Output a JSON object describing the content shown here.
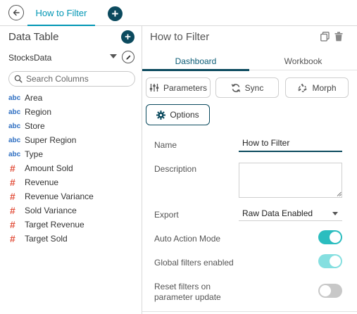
{
  "top_tabs": {
    "active_tab_label": "How to Filter"
  },
  "data_table": {
    "title": "Data Table",
    "data_source": "StocksData",
    "search_placeholder": "Search Columns",
    "columns": [
      {
        "type": "text",
        "type_badge": "abc",
        "label": "Area"
      },
      {
        "type": "text",
        "type_badge": "abc",
        "label": "Region"
      },
      {
        "type": "text",
        "type_badge": "abc",
        "label": "Store"
      },
      {
        "type": "text",
        "type_badge": "abc",
        "label": "Super Region"
      },
      {
        "type": "text",
        "type_badge": "abc",
        "label": "Type"
      },
      {
        "type": "number",
        "type_badge": "#",
        "label": "Amount Sold"
      },
      {
        "type": "number",
        "type_badge": "#",
        "label": "Revenue"
      },
      {
        "type": "number",
        "type_badge": "#",
        "label": "Revenue Variance"
      },
      {
        "type": "number",
        "type_badge": "#",
        "label": "Sold Variance"
      },
      {
        "type": "number",
        "type_badge": "#",
        "label": "Target Revenue"
      },
      {
        "type": "number",
        "type_badge": "#",
        "label": "Target Sold"
      }
    ]
  },
  "properties": {
    "title": "How to Filter",
    "subtabs": {
      "dashboard": "Dashboard",
      "workbook": "Workbook"
    },
    "buttons": {
      "parameters": "Parameters",
      "sync": "Sync",
      "morph": "Morph",
      "options": "Options"
    },
    "form": {
      "name_label": "Name",
      "name_value": "How to Filter",
      "description_label": "Description",
      "description_value": "",
      "export_label": "Export",
      "export_value": "Raw Data Enabled",
      "auto_action_label": "Auto Action Mode",
      "auto_action_on": true,
      "global_filters_label": "Global filters enabled",
      "global_filters_on": true,
      "reset_filters_label_line1": "Reset filters on",
      "reset_filters_label_line2": "parameter update",
      "reset_filters_on": false
    }
  },
  "colors": {
    "accent": "#0096b4",
    "dark_teal": "#0b4a5e",
    "toggle_on": "#2bbdbf",
    "text_type": "#2f6fc2",
    "number_type": "#e2503c"
  },
  "icons": {
    "back": "back-arrow-icon",
    "add": "plus-icon",
    "edit": "pencil-icon",
    "search": "search-icon",
    "copy": "copy-icon",
    "delete": "trash-icon",
    "parameters": "sliders-icon",
    "sync": "sync-icon",
    "morph": "recycle-icon",
    "options": "gear-icon"
  }
}
